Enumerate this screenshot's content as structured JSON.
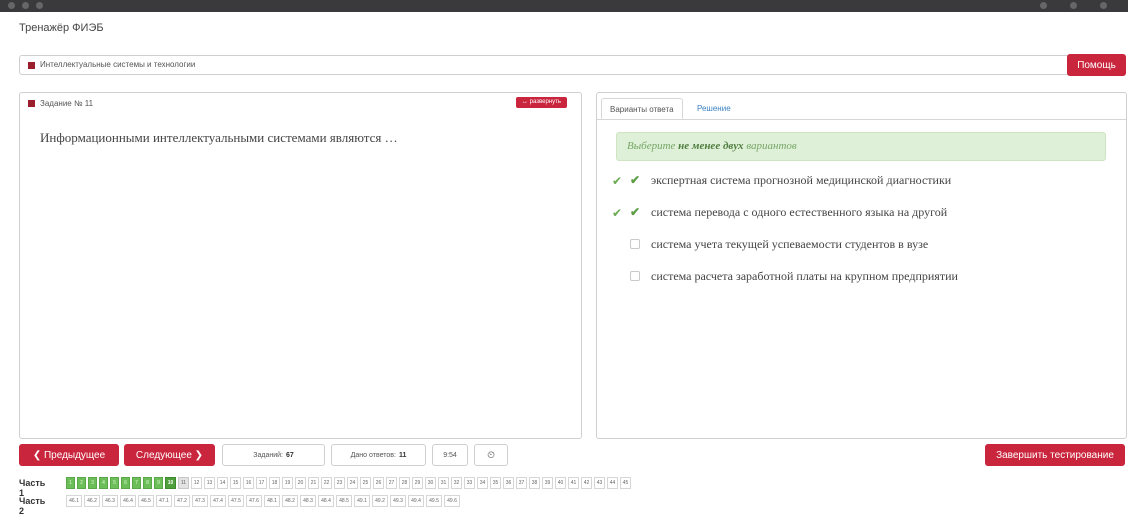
{
  "app_title": "Тренажёр ФИЭБ",
  "topic": {
    "label": "Интеллектуальные системы и технологии",
    "help_label": "Помощь"
  },
  "task": {
    "header": "Задание № 11",
    "expand_label": "↔ развернуть",
    "question": "Информационными интеллектуальными системами являются …"
  },
  "answers": {
    "tabs": [
      {
        "label": "Варианты ответа",
        "active": true
      },
      {
        "label": "Решение",
        "active": false
      }
    ],
    "hint_pre": "Выберите",
    "hint_bold": "не менее двух",
    "hint_post": "вариантов",
    "options": [
      {
        "text": "экспертная система прогнозной медицинской диагностики",
        "checked": true,
        "correct": true
      },
      {
        "text": "система перевода с одного естественного языка на другой",
        "checked": true,
        "correct": true
      },
      {
        "text": "система учета текущей успеваемости студентов в вузе",
        "checked": false,
        "correct": false
      },
      {
        "text": "система расчета заработной платы на крупном предприятии",
        "checked": false,
        "correct": false
      }
    ]
  },
  "footer": {
    "prev_label": "❮ Предыдущее",
    "next_label": "Следующее ❯",
    "tasks_label": "Заданий:",
    "tasks_count": "67",
    "answered_label": "Дано ответов:",
    "answered_count": "11",
    "timer": "9:54",
    "clock_icon": "clock-icon",
    "finish_label": "Завершить тестирование"
  },
  "parts": [
    {
      "label": "Часть 1",
      "items": [
        "1",
        "2",
        "3",
        "4",
        "5",
        "6",
        "7",
        "8",
        "9",
        "10",
        "11",
        "12",
        "13",
        "14",
        "15",
        "16",
        "17",
        "18",
        "19",
        "20",
        "21",
        "22",
        "23",
        "24",
        "25",
        "26",
        "27",
        "28",
        "29",
        "30",
        "31",
        "32",
        "33",
        "34",
        "35",
        "36",
        "37",
        "38",
        "39",
        "40",
        "41",
        "42",
        "43",
        "44",
        "45"
      ],
      "done_count": 10,
      "current": "10",
      "selected": "11"
    },
    {
      "label": "Часть 2",
      "items": [
        "46.1",
        "46.2",
        "46.3",
        "46.4",
        "46.5",
        "47.1",
        "47.2",
        "47.3",
        "47.4",
        "47.5",
        "47.6",
        "48.1",
        "48.2",
        "48.3",
        "48.4",
        "48.5",
        "49.1",
        "49.2",
        "49.3",
        "49.4",
        "49.5",
        "49.6"
      ],
      "done_count": 0,
      "current": "",
      "selected": ""
    }
  ],
  "colors": {
    "accent": "#c9253d",
    "done": "#6cbf58",
    "hint_bg": "#dff0d8"
  }
}
